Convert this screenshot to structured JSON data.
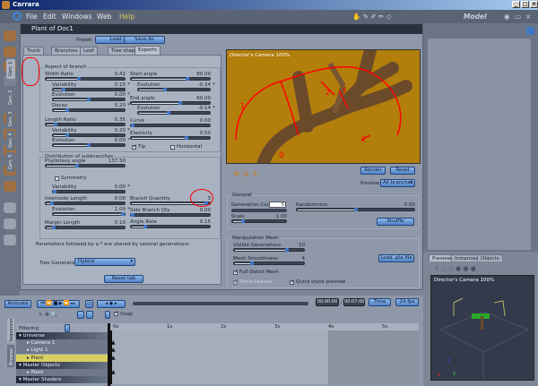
{
  "app": {
    "title": "Carrara",
    "model_label": "Model"
  },
  "menu": [
    "File",
    "Edit",
    "Windows",
    "Web",
    "Help"
  ],
  "doc": {
    "title": "Plant of Doc1",
    "preset_label": "Preset:",
    "load": "Load",
    "save_as": "Save As"
  },
  "tabs": [
    "Trunk",
    "Branches",
    "Leaf",
    "Tree shape",
    "Experts"
  ],
  "active_tab": "Experts",
  "gen_tabs": [
    "Gen. 1",
    "Gen. 2",
    "Gen. 3",
    "Gen. 4",
    "Gen. 5"
  ],
  "aspect": {
    "title": "Aspect of branch",
    "sliders": [
      {
        "label": "Width Ratio",
        "value": "0.42",
        "pos": 0.42
      },
      {
        "label": "Variability",
        "value": "0.15",
        "star": "*",
        "pos": 0.15
      },
      {
        "label": "Evolution",
        "value": "0.00",
        "star": "*",
        "pos": 0.5
      },
      {
        "label": "Decay",
        "value": "0.20",
        "star": "*",
        "pos": 0.2
      },
      {
        "label": "Length Ratio",
        "value": "0.35",
        "pos": 0.12
      },
      {
        "label": "Variability",
        "value": "0.20",
        "star": "*",
        "pos": 0.2
      },
      {
        "label": "Evolution",
        "value": "0.00",
        "star": "*",
        "pos": 0.5
      },
      {
        "label": "Start angle",
        "value": "80.00",
        "pos": 0.72
      },
      {
        "label": "Evolution",
        "value": "-0.24",
        "star": "*",
        "pos": 0.38
      },
      {
        "label": "End angle",
        "value": "60.00",
        "pos": 0.62
      },
      {
        "label": "Evolution",
        "value": "-0.14",
        "star": "*",
        "pos": 0.43
      },
      {
        "label": "Curve",
        "value": "0.00",
        "pos": 0.02
      },
      {
        "label": "Elasticity",
        "value": "0.50",
        "pos": 0.7
      }
    ],
    "tip": "Tip",
    "horizontal": "Horizontal"
  },
  "distribution": {
    "title": "Distribution of subbranches",
    "symmetry": "Symmetry",
    "sliders": [
      {
        "label": "Phyllotaxy angle",
        "value": "137.50",
        "pos": 0.4
      },
      {
        "label": "Variability",
        "value": "0.00",
        "star": "*",
        "pos": 0.02
      },
      {
        "label": "Internode Length",
        "value": "0.08",
        "pos": 0.08
      },
      {
        "label": "Evolution",
        "value": "1.00",
        "star": "*",
        "pos": 0.98
      },
      {
        "label": "Margin Length",
        "value": "0.10",
        "pos": 0.1
      },
      {
        "label": "Branch Quantity",
        "value": "3",
        "pos": 0.95
      },
      {
        "label": "Side Branch Qty",
        "value": "0.00",
        "pos": 0.02
      },
      {
        "label": "Angle Rate",
        "value": "0.15",
        "pos": 0.18
      }
    ]
  },
  "note": "Parameters followed by a * are shared by several generations.",
  "tree_generator": {
    "label": "Tree Generator",
    "value": "Hybrid"
  },
  "reset_tab": "Reset tab",
  "view": {
    "label": "Director's Camera 100%"
  },
  "render": "Render",
  "reset": "Reset",
  "preview_select": {
    "label": "Preview",
    "value": "All branches"
  },
  "general": {
    "title": "General",
    "gen_count_label": "Generation Count",
    "gen_count": "5",
    "sliders": [
      {
        "label": "Scale",
        "value": "1.00",
        "pos": 0.2
      },
      {
        "label": "Randomness",
        "value": "0.50",
        "pos": 0.5
      }
    ],
    "shuffle": "Shuffle"
  },
  "mesh": {
    "title": "Manipulation Mesh",
    "sliders": [
      {
        "label": "Visible Generations",
        "value": "10",
        "pos": 0.75
      },
      {
        "label": "Mesh Smoothness",
        "value": "4",
        "pos": 0.25
      }
    ],
    "full_detail": "Full-Detail Mesh",
    "show_leaves": "Show Leaves",
    "quick_trunk": "Quick trunk preview",
    "load_pla": "Load .pla file"
  },
  "preview_tabs": [
    "Preview",
    "Instances",
    "Objects"
  ],
  "preview_cam": "Director's Camera 100%",
  "timeline": {
    "animate": "Animate",
    "snap": "Snap",
    "filtering": "Filtering",
    "time_current": "00:00:00",
    "time_end": "00:07:00",
    "time_mode": "Time",
    "fps": "24 fps",
    "ticks": [
      "0s",
      "1s",
      "2s",
      "3s",
      "4s",
      "5s"
    ],
    "side_tabs": [
      "Sequencer",
      "Browser"
    ],
    "rows": [
      {
        "label": "Universe",
        "type": "header"
      },
      {
        "label": "Camera 1",
        "type": "item"
      },
      {
        "label": "Light 1",
        "type": "item"
      },
      {
        "label": "Plant",
        "type": "selected"
      },
      {
        "label": "Master Objects",
        "type": "header"
      },
      {
        "label": "Plant",
        "type": "item"
      },
      {
        "label": "Master Shaders",
        "type": "header"
      }
    ]
  },
  "annotations": {
    "color": "#ff0000"
  }
}
